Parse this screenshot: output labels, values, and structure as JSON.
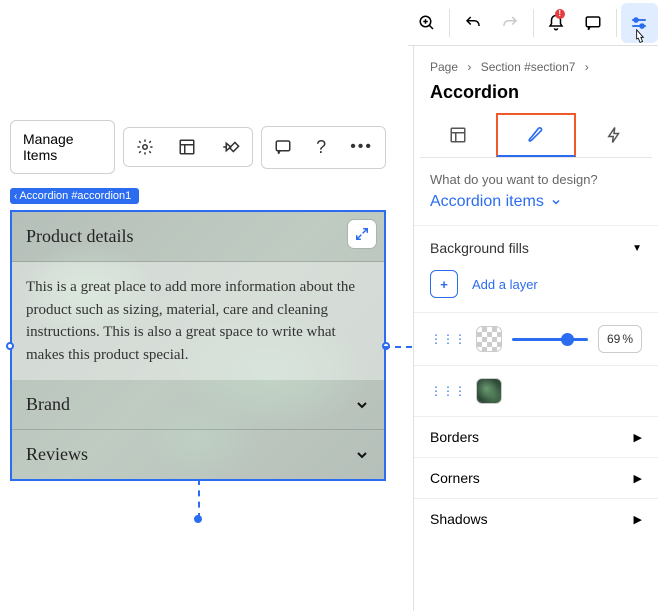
{
  "toolbar": {
    "manage_items": "Manage Items"
  },
  "pill": {
    "label": "Accordion #accordion1"
  },
  "accordion_preview": {
    "items": [
      {
        "title": "Product details",
        "body": "This is a great place to add more information about the product such as sizing, material, care and cleaning instructions. This is also a great space to write what makes this product special.",
        "expanded": true
      },
      {
        "title": "Brand",
        "expanded": false
      },
      {
        "title": "Reviews",
        "expanded": false
      }
    ]
  },
  "breadcrumbs": [
    "Page",
    "Section #section7"
  ],
  "panel": {
    "title": "Accordion",
    "design_question": "What do you want to design?",
    "design_target": "Accordion items",
    "sections": {
      "background_fills": "Background fills",
      "add_layer": "Add a layer",
      "opacity_value": "69",
      "opacity_suffix": "%",
      "borders": "Borders",
      "corners": "Corners",
      "shadows": "Shadows"
    }
  }
}
